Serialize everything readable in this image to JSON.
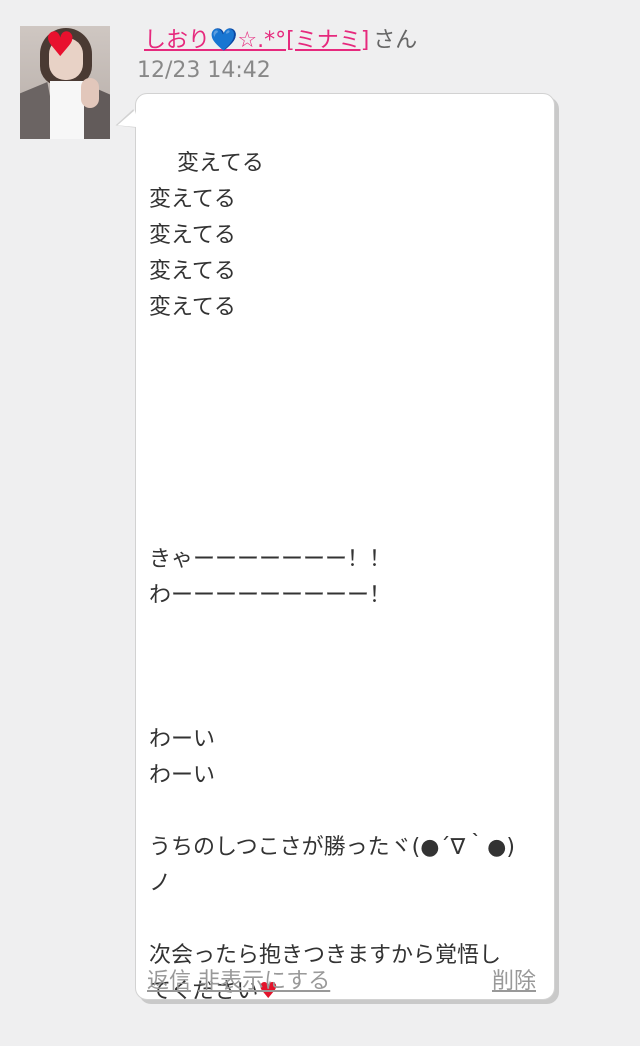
{
  "author": {
    "name": "しおり💙☆.*°[ミナミ]",
    "suffix": "さん"
  },
  "timestamp": "12/23 14:42",
  "message": {
    "lines": [
      "変えてる",
      "変えてる",
      "変えてる",
      "変えてる",
      "変えてる",
      "",
      "",
      "",
      "",
      "",
      "",
      "きゃーーーーーーー！！",
      "わーーーーーーーーー！",
      "",
      "",
      "",
      "わーい",
      "わーい",
      "",
      "うちのしつこさが勝ったヾ(●´∇｀●)",
      "ノ",
      "",
      "次会ったら抱きつきますから覚悟し",
      "てください"
    ],
    "end_emoji": "heart"
  },
  "actions": {
    "reply": "返信",
    "hide": "非表示にする",
    "delete": "削除"
  },
  "colors": {
    "author": "#e6297d",
    "heart": "#e3142b",
    "action": "#999999"
  }
}
